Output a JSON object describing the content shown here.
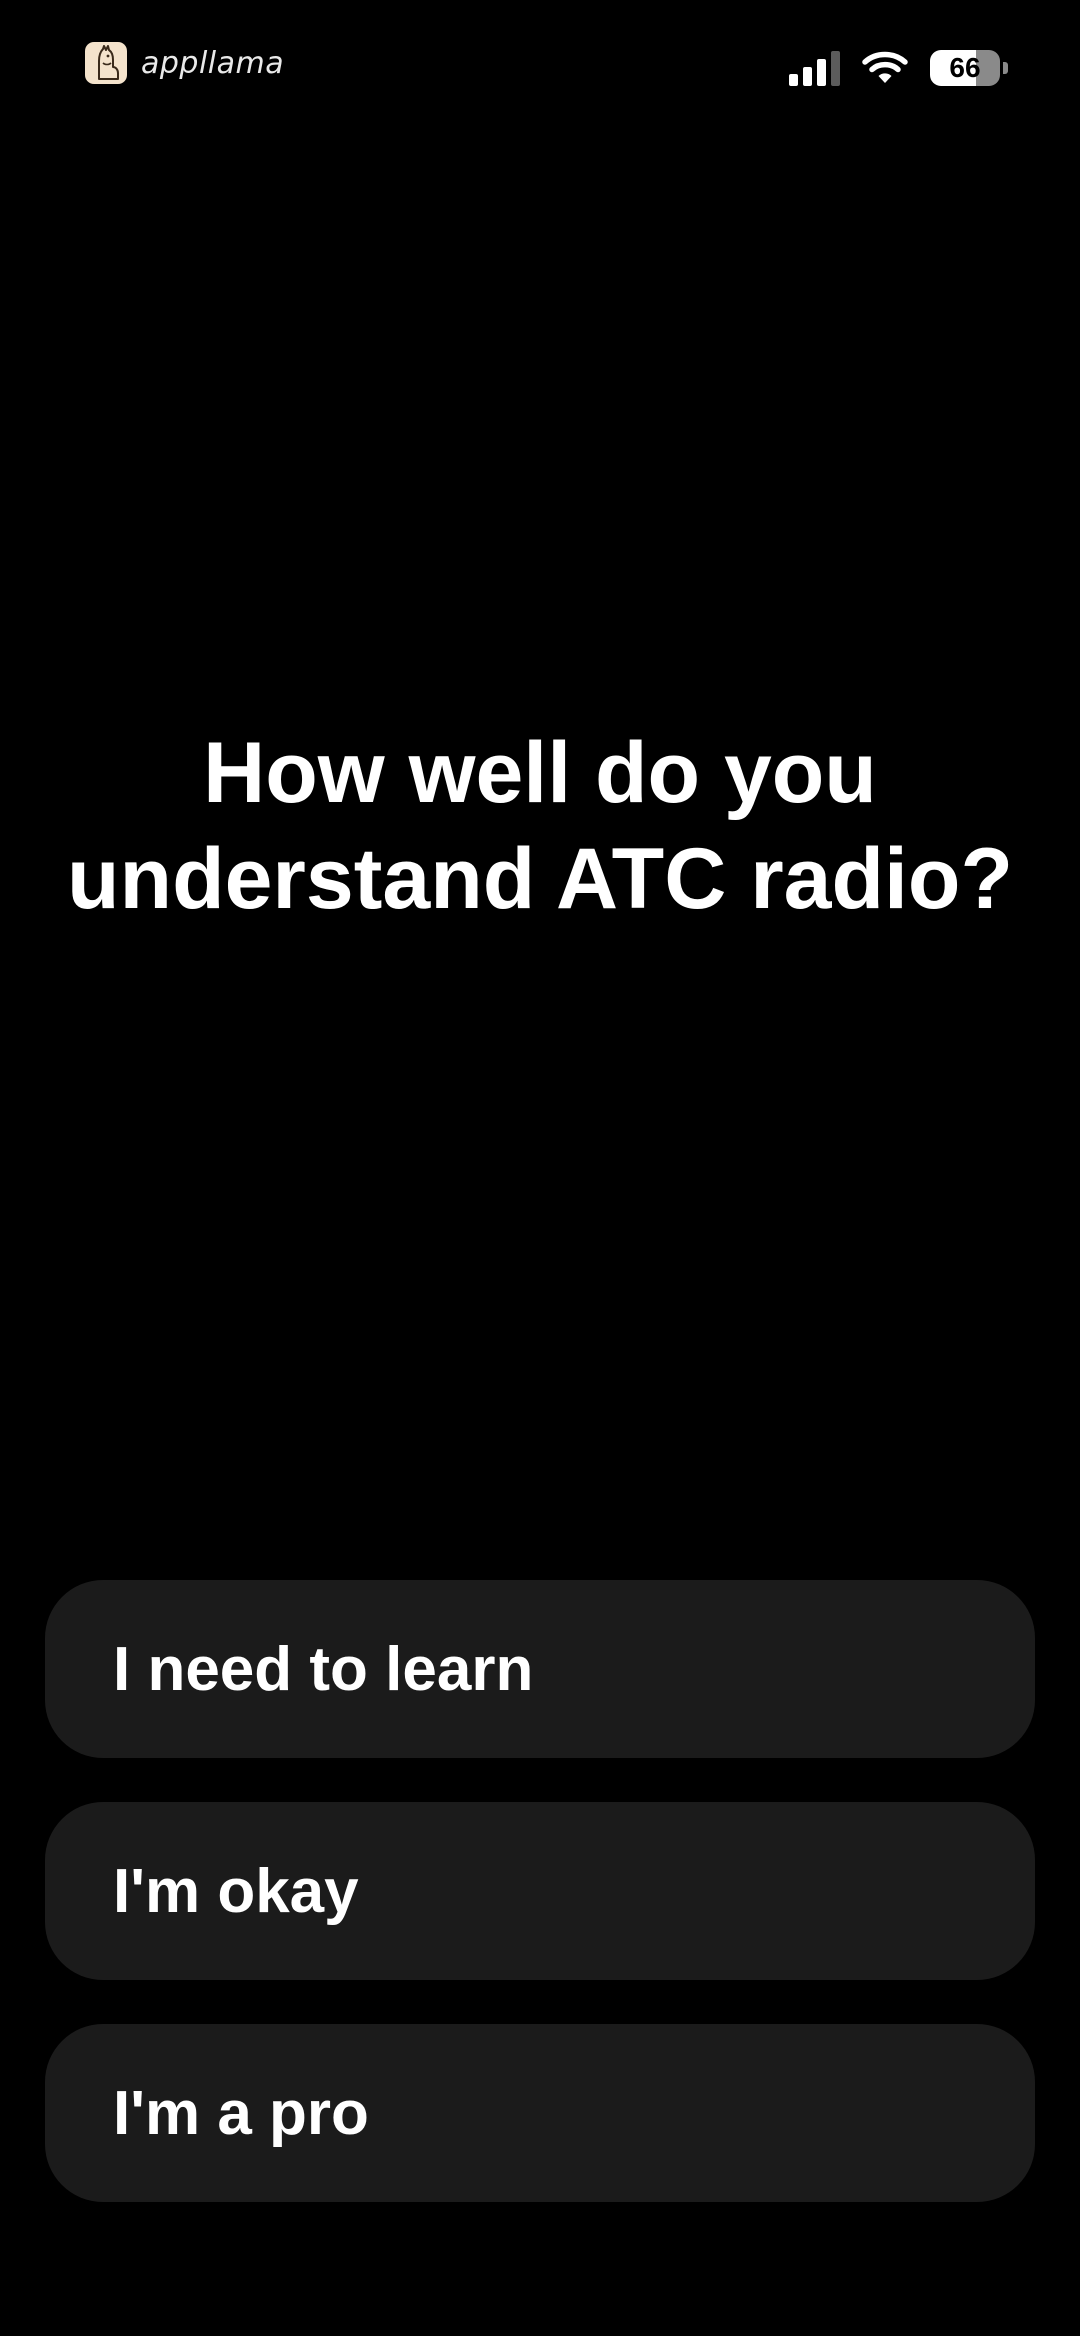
{
  "status_bar": {
    "brand_name": "appllama",
    "battery_level": "66",
    "icons": {
      "logo": "llama-logo-icon",
      "signal": "cellular-signal-icon",
      "wifi": "wifi-icon",
      "battery": "battery-icon"
    },
    "signal_bars_active": 3,
    "signal_bars_total": 4
  },
  "question": {
    "line1": "How well do you",
    "line2": "understand ATC radio?"
  },
  "options": [
    {
      "label": "I need to learn"
    },
    {
      "label": "I'm okay"
    },
    {
      "label": "I'm a pro"
    }
  ],
  "colors": {
    "background": "#000000",
    "text": "#ffffff",
    "option_background": "#1b1b1b",
    "logo_background": "#f4e3cc"
  }
}
